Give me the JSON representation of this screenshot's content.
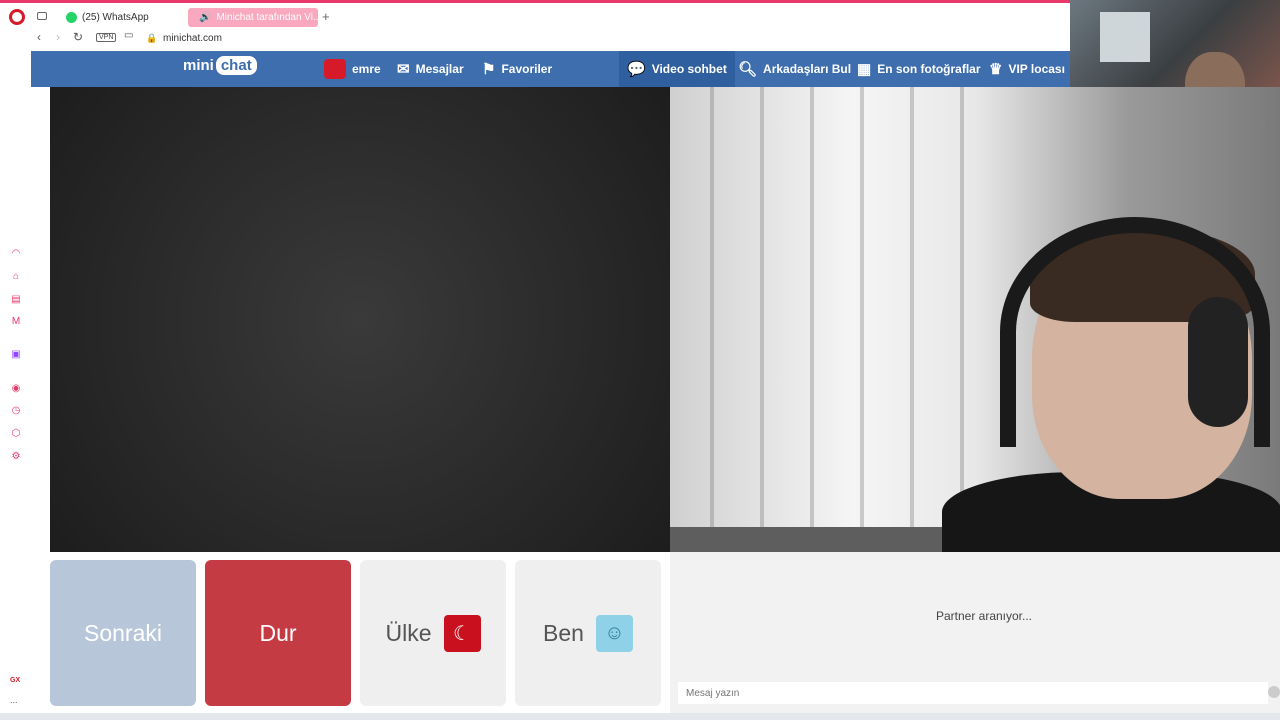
{
  "browser": {
    "tabs": [
      {
        "label": "(25) WhatsApp"
      },
      {
        "label": "Minichat tarafından Vi..."
      }
    ],
    "new_tab": "+",
    "vpn_badge": "VPN",
    "url": "minichat.com",
    "gx_label": "GX",
    "more_label": "..."
  },
  "site": {
    "logo_mini": "mini",
    "logo_chat": "chat",
    "nav": {
      "user": "emre",
      "messages": "Mesajlar",
      "favorites": "Favoriler",
      "video_chat": "Video sohbet",
      "find_friends": "Arkadaşları Bul",
      "latest_photos": "En son fotoğraflar",
      "vip": "VIP locası"
    }
  },
  "controls": {
    "next": "Sonraki",
    "stop": "Dur",
    "country": "Ülke",
    "me": "Ben"
  },
  "chat": {
    "status": "Partner aranıyor...",
    "input_placeholder": "Mesaj yazın"
  },
  "colors": {
    "nav_bg": "#3e6eae",
    "stop_red": "#c43b44",
    "next_blue": "#b7c7d9",
    "opera_red": "#d71a2a"
  }
}
